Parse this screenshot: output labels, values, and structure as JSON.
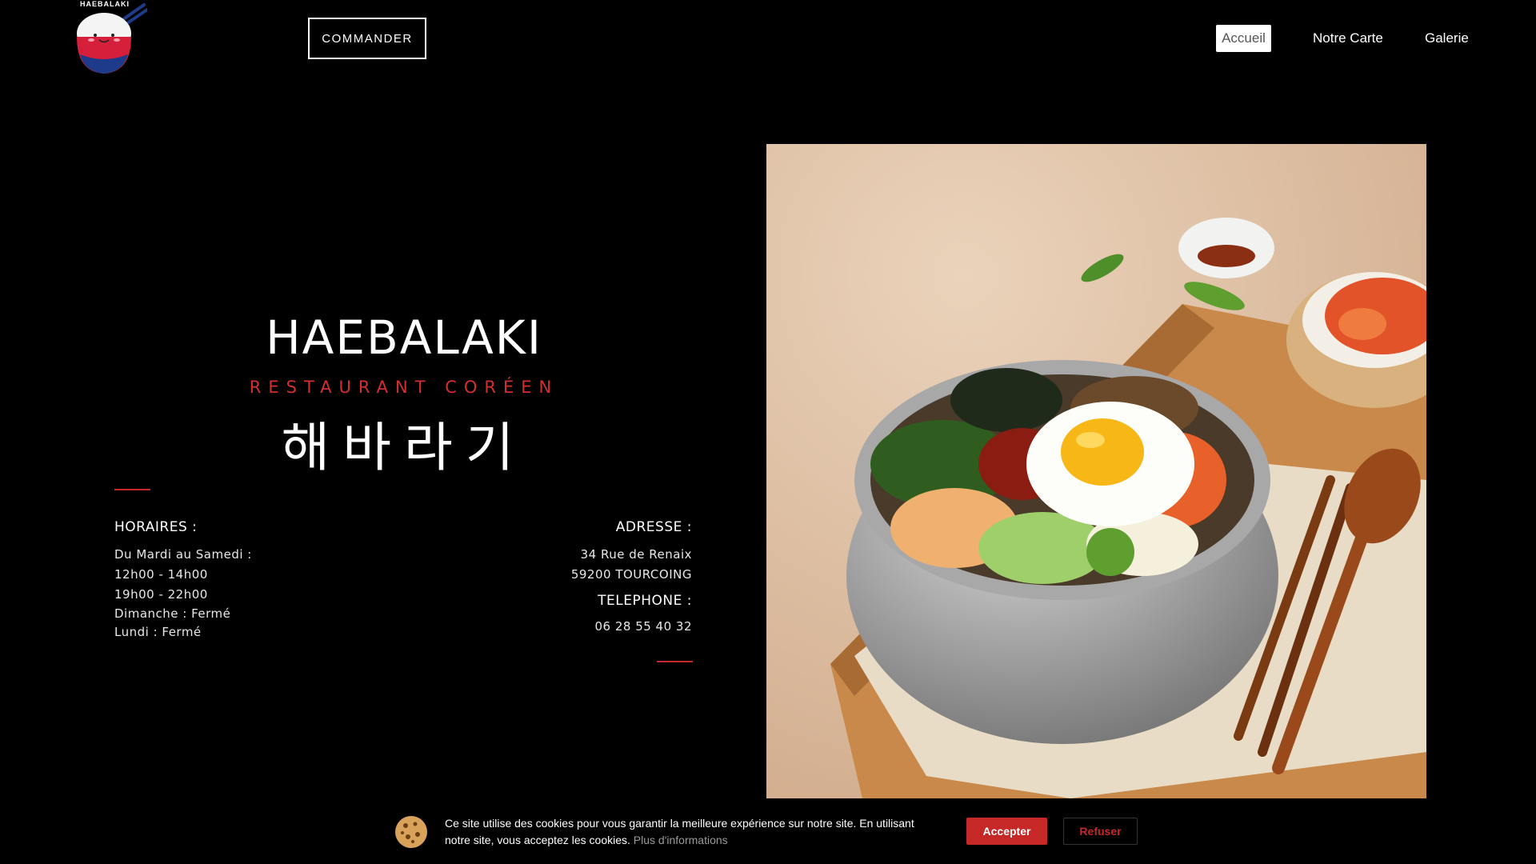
{
  "header": {
    "logo_text": "HAEBALAKI",
    "order_button": "COMMANDER",
    "nav": [
      {
        "label": "Accueil",
        "active": true
      },
      {
        "label": "Notre Carte",
        "active": false
      },
      {
        "label": "Galerie",
        "active": false
      }
    ]
  },
  "hero": {
    "brand": "HAEBALAKI",
    "subtitle": "RESTAURANT CORÉEN",
    "korean": "해바라기"
  },
  "hours": {
    "title": "HORAIRES :",
    "lines": [
      "Du Mardi au Samedi :",
      "12h00 - 14h00",
      "19h00 - 22h00",
      "Dimanche : Fermé",
      "Lundi : Fermé"
    ]
  },
  "address": {
    "title": "ADRESSE :",
    "lines": [
      "34 Rue de Renaix",
      "59200 TOURCOING"
    ]
  },
  "phone": {
    "title": "TELEPHONE :",
    "number": "06 28 55 40 32"
  },
  "cookie": {
    "text": "Ce site utilise des cookies pour vous garantir la meilleure expérience sur notre site. En utilisant notre site, vous acceptez les cookies.",
    "more": "Plus d'informations",
    "accept": "Accepter",
    "refuse": "Refuser"
  },
  "colors": {
    "accent_red": "#c62828",
    "background": "#000000"
  }
}
